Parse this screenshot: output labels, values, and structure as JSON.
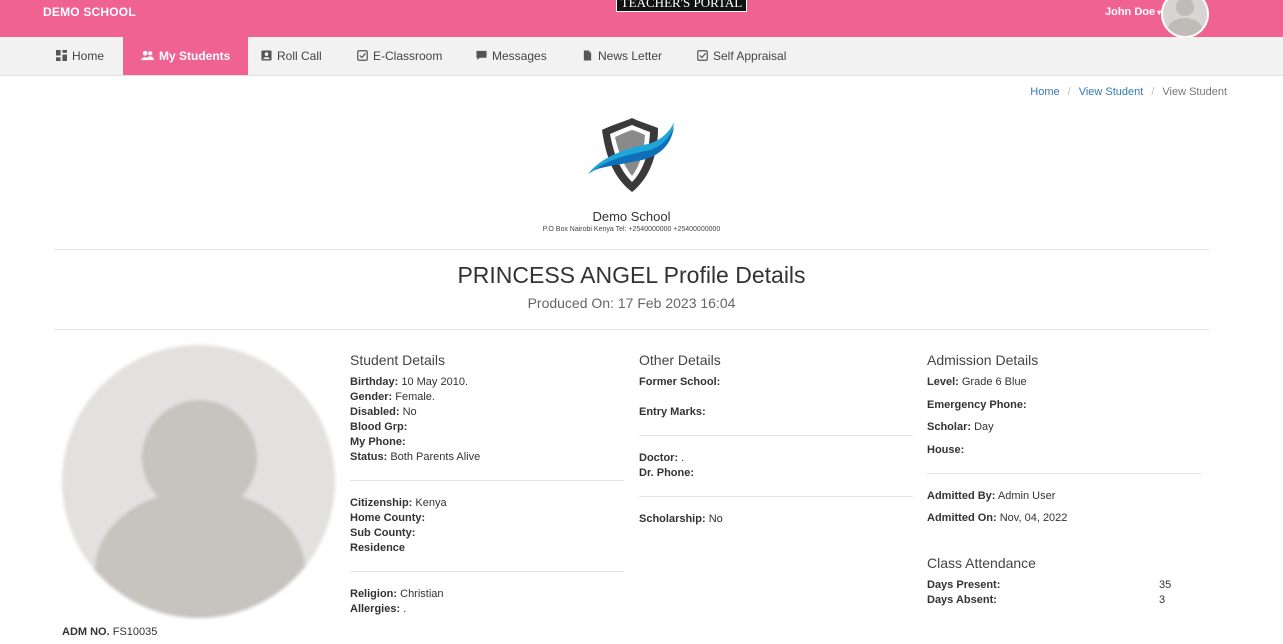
{
  "header": {
    "brand": "DEMO SCHOOL",
    "portal_title": "TEACHER'S PORTAL",
    "user_name": "John Doe",
    "caret": "▾"
  },
  "nav": {
    "items": [
      {
        "label": "Home",
        "icon": "dashboard-icon"
      },
      {
        "label": "My Students",
        "icon": "users-icon",
        "active": true
      },
      {
        "label": "Roll Call",
        "icon": "contact-card-icon"
      },
      {
        "label": "E-Classroom",
        "icon": "checkbox-icon"
      },
      {
        "label": "Messages",
        "icon": "chat-icon"
      },
      {
        "label": "News Letter",
        "icon": "document-icon"
      },
      {
        "label": "Self Appraisal",
        "icon": "checkbox-icon"
      }
    ]
  },
  "breadcrumb": {
    "items": [
      "Home",
      "View Student",
      "View Student"
    ],
    "separator": "/"
  },
  "school": {
    "name": "Demo School",
    "address": "P.O Box Nairobi Kenya Tel: +2540000000 +25400000000"
  },
  "profile": {
    "title": "PRINCESS ANGEL Profile Details",
    "produced": "Produced On: 17 Feb 2023 16:04",
    "adm_label": "ADM NO.",
    "adm_value": "FS10035"
  },
  "student_details": {
    "title": "Student Details",
    "group1": [
      {
        "label": "Birthday:",
        "value": "10 May 2010."
      },
      {
        "label": "Gender:",
        "value": "Female."
      },
      {
        "label": "Disabled:",
        "value": "No"
      },
      {
        "label": "Blood Grp:",
        "value": ""
      },
      {
        "label": "My Phone:",
        "value": ""
      },
      {
        "label": "Status:",
        "value": "Both Parents Alive"
      }
    ],
    "group2": [
      {
        "label": "Citizenship:",
        "value": "Kenya"
      },
      {
        "label": "Home County:",
        "value": ""
      },
      {
        "label": "Sub County:",
        "value": ""
      },
      {
        "label": "Residence",
        "value": ""
      }
    ],
    "group3": [
      {
        "label": "Religion:",
        "value": "Christian"
      },
      {
        "label": "Allergies:",
        "value": "."
      }
    ]
  },
  "other_details": {
    "title": "Other Details",
    "former_school": {
      "label": "Former School:",
      "value": ""
    },
    "entry_marks": {
      "label": "Entry Marks:",
      "value": ""
    },
    "doctor": {
      "label": "Doctor:",
      "value": "."
    },
    "dr_phone": {
      "label": "Dr. Phone:",
      "value": ""
    },
    "scholarship": {
      "label": "Scholarship:",
      "value": "No"
    }
  },
  "admission_details": {
    "title": "Admission Details",
    "level": {
      "label": "Level:",
      "value": "Grade 6 Blue"
    },
    "emergency_phone": {
      "label": "Emergency Phone:",
      "value": ""
    },
    "scholar": {
      "label": "Scholar:",
      "value": "Day"
    },
    "house": {
      "label": "House:",
      "value": ""
    },
    "admitted_by": {
      "label": "Admitted By:",
      "value": "Admin User"
    },
    "admitted_on": {
      "label": "Admitted On:",
      "value": "Nov, 04, 2022"
    }
  },
  "attendance": {
    "title": "Class Attendance",
    "days_present": {
      "label": "Days Present:",
      "value": "35"
    },
    "days_absent": {
      "label": "Days Absent:",
      "value": "3"
    }
  },
  "colors": {
    "accent": "#f06292",
    "link": "#337ab7"
  }
}
